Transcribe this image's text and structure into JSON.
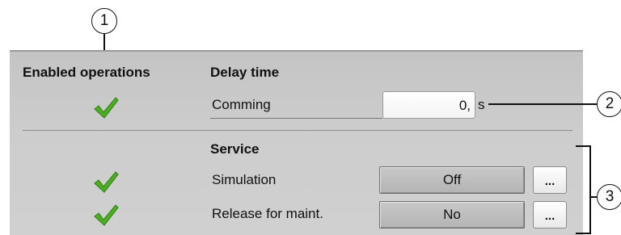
{
  "callouts": {
    "c1": "1",
    "c2": "2",
    "c3": "3"
  },
  "header": {
    "enabled_operations": "Enabled operations",
    "delay_time": "Delay time"
  },
  "delay": {
    "label": "Comming",
    "value": "0,",
    "unit": "s"
  },
  "service": {
    "title": "Service",
    "rows": [
      {
        "label": "Simulation",
        "value": "Off",
        "more": "..."
      },
      {
        "label": "Release for maint.",
        "value": "No",
        "more": "..."
      }
    ]
  },
  "colors": {
    "check": "#4caf22",
    "panel": "#cbcbcb"
  },
  "icons": {
    "check": "check-icon"
  }
}
